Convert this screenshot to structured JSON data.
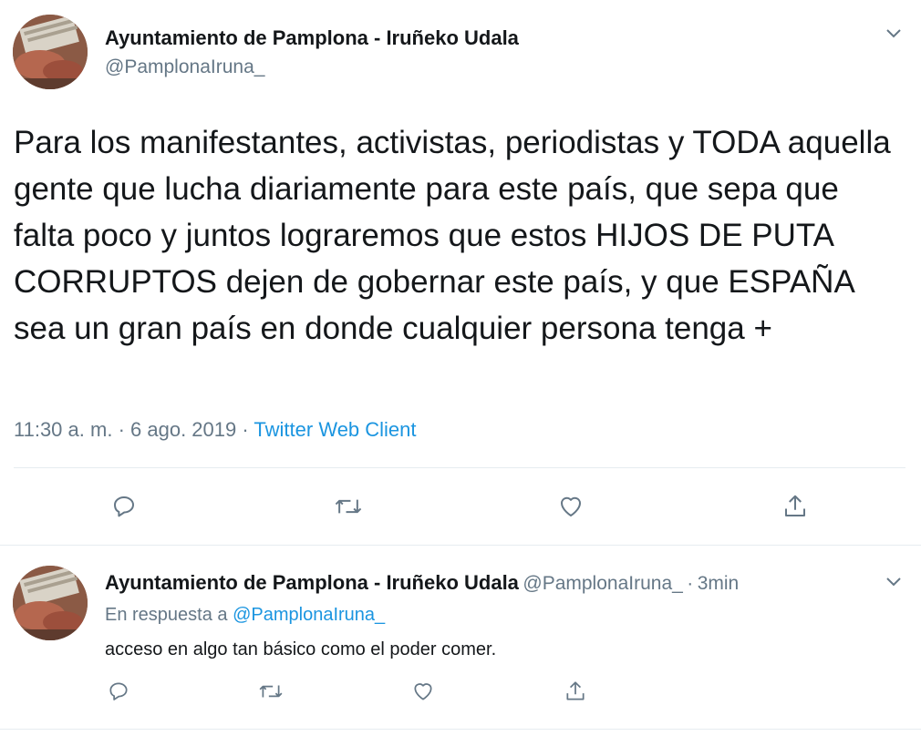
{
  "main_tweet": {
    "author_name": "Ayuntamiento de Pamplona - Iruñeko Udala",
    "author_handle": "@PamplonaIruna_",
    "text": "Para los manifestantes, activistas, periodistas y TODA aquella gente que lucha diariamente para este país, que sepa que falta poco y juntos lograremos que estos HIJOS DE PUTA CORRUPTOS dejen de gobernar este país, y que ESPAÑA sea un gran país en donde cualquier persona tenga +",
    "time": "11:30 a. m.",
    "separator": "·",
    "date": "6 ago. 2019",
    "source": "Twitter Web Client",
    "actions": [
      "reply-icon",
      "retweet-icon",
      "like-icon",
      "share-icon"
    ]
  },
  "reply_tweet": {
    "author_name": "Ayuntamiento de Pamplona - Iruñeko Udala",
    "author_handle": "@PamplonaIruna_",
    "separator": "·",
    "age": "3min",
    "reply_prefix": "En respuesta a",
    "reply_handle": "@PamplonaIruna_",
    "text": "acceso en algo tan básico como el poder comer.",
    "actions": [
      "reply-icon",
      "retweet-icon",
      "like-icon",
      "share-icon"
    ]
  },
  "colors": {
    "text": "#14171a",
    "secondary": "#657786",
    "link": "#1b95e0",
    "divider": "#e6ecf0"
  }
}
